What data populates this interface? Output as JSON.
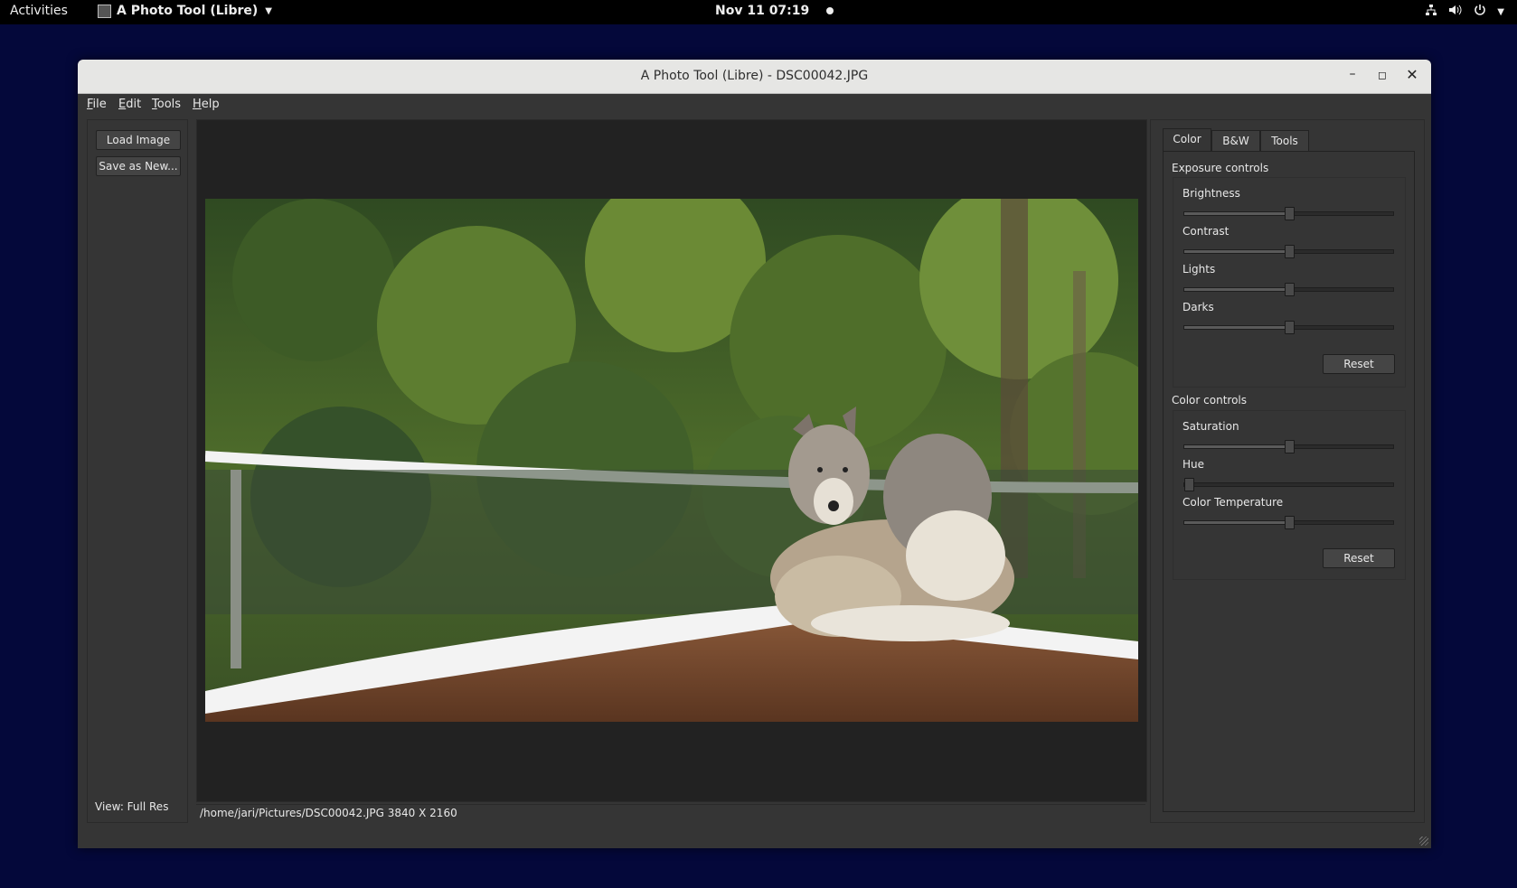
{
  "topbar": {
    "activities": "Activities",
    "app_name": "A Photo Tool (Libre)",
    "clock": "Nov 11  07:19"
  },
  "window": {
    "title": "A Photo Tool (Libre) - DSC00042.JPG"
  },
  "menu": [
    "File",
    "Edit",
    "Tools",
    "Help"
  ],
  "left_panel": {
    "load_label": "Load Image",
    "save_label": "Save as New...",
    "view_label": "View: Full Res"
  },
  "status": {
    "path": "/home/jari/Pictures/DSC00042.JPG 3840 X 2160"
  },
  "tabs": [
    "Color",
    "B&W",
    "Tools"
  ],
  "active_tab": "Color",
  "exposure": {
    "title": "Exposure controls",
    "sliders": [
      {
        "label": "Brightness",
        "value": 0.5
      },
      {
        "label": "Contrast",
        "value": 0.5
      },
      {
        "label": "Lights",
        "value": 0.5
      },
      {
        "label": "Darks",
        "value": 0.5
      }
    ],
    "reset_label": "Reset"
  },
  "color": {
    "title": "Color controls",
    "sliders": [
      {
        "label": "Saturation",
        "value": 0.5
      },
      {
        "label": "Hue",
        "value": 0.0
      },
      {
        "label": "Color Temperature",
        "value": 0.5
      }
    ],
    "reset_label": "Reset"
  },
  "colors": {
    "desktop": "#04083a",
    "window_bg": "#353535",
    "viewer_bg": "#222222"
  }
}
